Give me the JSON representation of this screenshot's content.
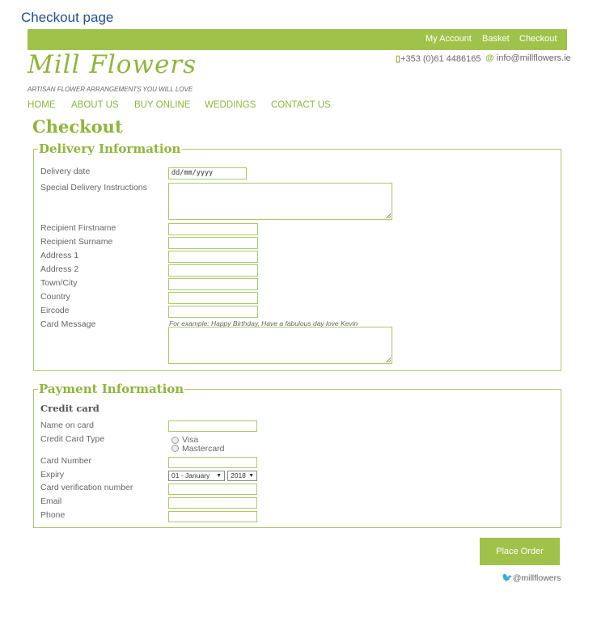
{
  "page_label": "Checkout page",
  "topbar": {
    "my_account": "My Account",
    "basket": "Basket",
    "checkout": "Checkout"
  },
  "brand": {
    "logo": "Mill Flowers",
    "tagline": "ARTISAN FLOWER ARRANGEMENTS YOU WILL LOVE"
  },
  "contact": {
    "phone": "+353 (0)61 4486165",
    "email": "info@millflowers.ie"
  },
  "nav": [
    "HOME",
    "ABOUT US",
    "BUY ONLINE",
    "WEDDINGS",
    "CONTACT US"
  ],
  "heading": "Checkout",
  "delivery": {
    "legend": "Delivery Information",
    "date_label": "Delivery date",
    "date_placeholder": "dd/mm/yyyy",
    "instructions_label": "Special Delivery Instructions",
    "firstname_label": "Recipient Firstname",
    "surname_label": "Recipient Surname",
    "address1_label": "Address 1",
    "address2_label": "Address 2",
    "town_label": "Town/City",
    "country_label": "Country",
    "eircode_label": "Eircode",
    "card_message_label": "Card Message",
    "card_message_hint": "For example: Happy Birthday, Have a fabulous day love Kevin"
  },
  "payment": {
    "legend": "Payment Information",
    "subheading": "Credit card",
    "name_label": "Name on card",
    "type_label": "Credit Card Type",
    "type_options": [
      "Visa",
      "Mastercard"
    ],
    "number_label": "Card Number",
    "expiry_label": "Expiry",
    "expiry_month": "01 - January",
    "expiry_year": "2018",
    "cvn_label": "Card verification number",
    "email_label": "Email",
    "phone_label": "Phone"
  },
  "place_order": "Place Order",
  "twitter": "@millflowers",
  "colors": {
    "accent": "#9fc34a",
    "text": "#666666",
    "link_blue": "#1f4e8c"
  }
}
